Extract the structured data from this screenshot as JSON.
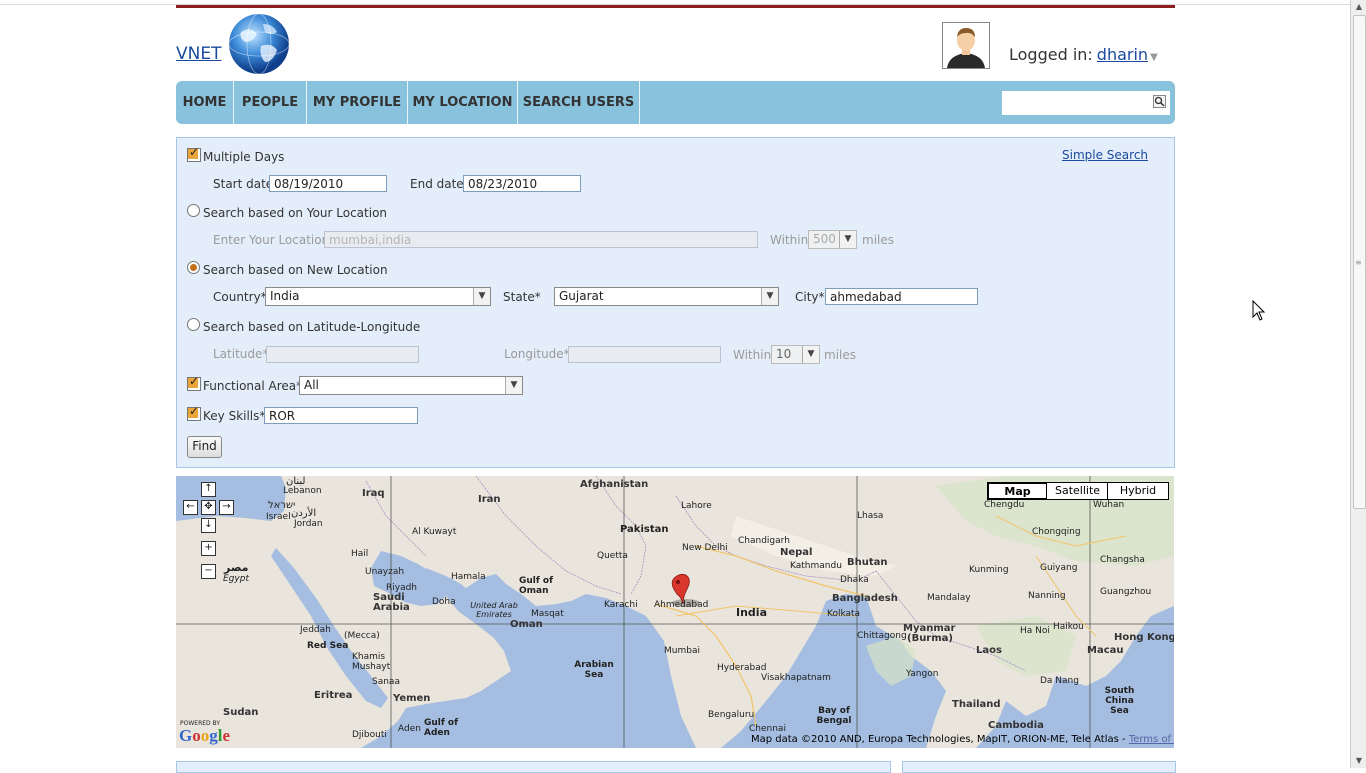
{
  "header": {
    "logo_text": "VNET",
    "logged_in_label": "Logged in:",
    "username": "dharin"
  },
  "nav": {
    "items": [
      "HOME",
      "PEOPLE",
      "MY PROFILE",
      "MY LOCATION",
      "SEARCH USERS"
    ],
    "search_placeholder": ""
  },
  "form": {
    "multiple_days_label": "Multiple Days",
    "multiple_days_checked": true,
    "simple_search_link": "Simple Search",
    "start_date_label": "Start date",
    "start_date_value": "08/19/2010",
    "end_date_label": "End date",
    "end_date_value": "08/23/2010",
    "your_location_label": "Search based on Your Location",
    "enter_location_label": "Enter Your Location",
    "enter_location_placeholder": "mumbai,india",
    "within_label": "Within",
    "within_value_1": "500",
    "miles_label": "miles",
    "new_location_label": "Search based on New Location",
    "country_label": "Country*",
    "country_value": "India",
    "state_label": "State*",
    "state_value": "Gujarat",
    "city_label": "City*",
    "city_value": "ahmedabad",
    "latlng_label": "Search based on Latitude-Longitude",
    "latitude_label": "Latitude*",
    "longitude_label": "Longitude*",
    "within_value_2": "10",
    "functional_area_label": "Functional Area*",
    "functional_area_value": "All",
    "key_skills_label": "Key Skills*",
    "key_skills_value": "ROR",
    "find_button": "Find"
  },
  "map": {
    "type_buttons": [
      "Map",
      "Satellite",
      "Hybrid"
    ],
    "selected_type": "Map",
    "powered_by": "POWERED BY",
    "google_logo": "Google",
    "attribution": "Map data ©2010 AND, Europa Technologies, MapIT, ORION-ME, Tele Atlas -",
    "terms_link": "Terms of Use",
    "labels": {
      "lebanon_ar": "لبنان",
      "lebanon": "Lebanon",
      "israel_he": "ישראל",
      "israel": "Israel",
      "jordan_ar": "الأردن",
      "jordan": "Jordan",
      "egypt_ar": "مصر",
      "egypt": "Egypt",
      "iraq": "Iraq",
      "iran": "Iran",
      "afghanistan": "Afghanistan",
      "pakistan": "Pakistan",
      "india": "India",
      "nepal": "Nepal",
      "bhutan": "Bhutan",
      "bangladesh": "Bangladesh",
      "myanmar": "Myanmar",
      "burma": "(Burma)",
      "saudi_arabia": "Saudi Arabia",
      "yemen": "Yemen",
      "eritrea": "Eritrea",
      "sudan": "Sudan",
      "djibouti": "Djibouti",
      "oman": "Oman",
      "uae": "United Arab Emirates",
      "red_sea": "Red Sea",
      "arabian_sea": "Arabian Sea",
      "bay_of_bengal": "Bay of Bengal",
      "gulf_of_oman": "Gulf of Oman",
      "gulf_of_aden": "Gulf of Aden",
      "laos": "Laos",
      "thailand": "Thailand",
      "cambodia": "Cambodia",
      "macau": "Macau",
      "hong_kong": "Hong Kong",
      "south_china_sea": "South China Sea",
      "lhasa": "Lhasa",
      "chengdu": "Chengdu",
      "chongqing": "Chongqing",
      "wuhan": "Wuhan",
      "changsha": "Changsha",
      "kunming": "Kunming",
      "guiyang": "Guiyang",
      "nanning": "Nanning",
      "guangzhou": "Guangzhou",
      "haikou": "Haikou",
      "karachi": "Karachi",
      "new_delhi": "New Delhi",
      "lahore": "Lahore",
      "mumbai": "Mumbai",
      "hyderabad": "Hyderabad",
      "bengaluru": "Bengaluru",
      "chennai": "Chennai",
      "kolkata": "Kolkata",
      "dhaka": "Dhaka",
      "chittagong": "Chittagong",
      "kathmandu": "Kathmandu",
      "visakhapatnam": "Visakhapatnam",
      "doha": "Doha",
      "riyadh": "Riyadh",
      "jeddah": "Jeddah",
      "mecca": "(Mecca)",
      "hail": "Hail",
      "unayzah": "Unayzah",
      "kuwait": "Al Kuwayt",
      "muscat": "Masqat",
      "sanaa": "Sanaa",
      "aden": "Aden",
      "yangon": "Yangon",
      "mandalay": "Mandalay",
      "hamala": "Hamala",
      "khamis": "Khamis Mushayt",
      "ahmedabad": "Ahmedabad",
      "chandigarh": "Chandigarh",
      "da_nang": "Da Nang",
      "hanoi": "Ha Noi",
      "quetta": "Quetta"
    }
  },
  "colors": {
    "nav_bg": "#89c2dc",
    "panel_bg": "#e4eefb",
    "accent_red": "#8b1f1f",
    "link": "#1a4a9e",
    "map_water": "#a4bde0",
    "map_land": "#e9e5dc"
  }
}
